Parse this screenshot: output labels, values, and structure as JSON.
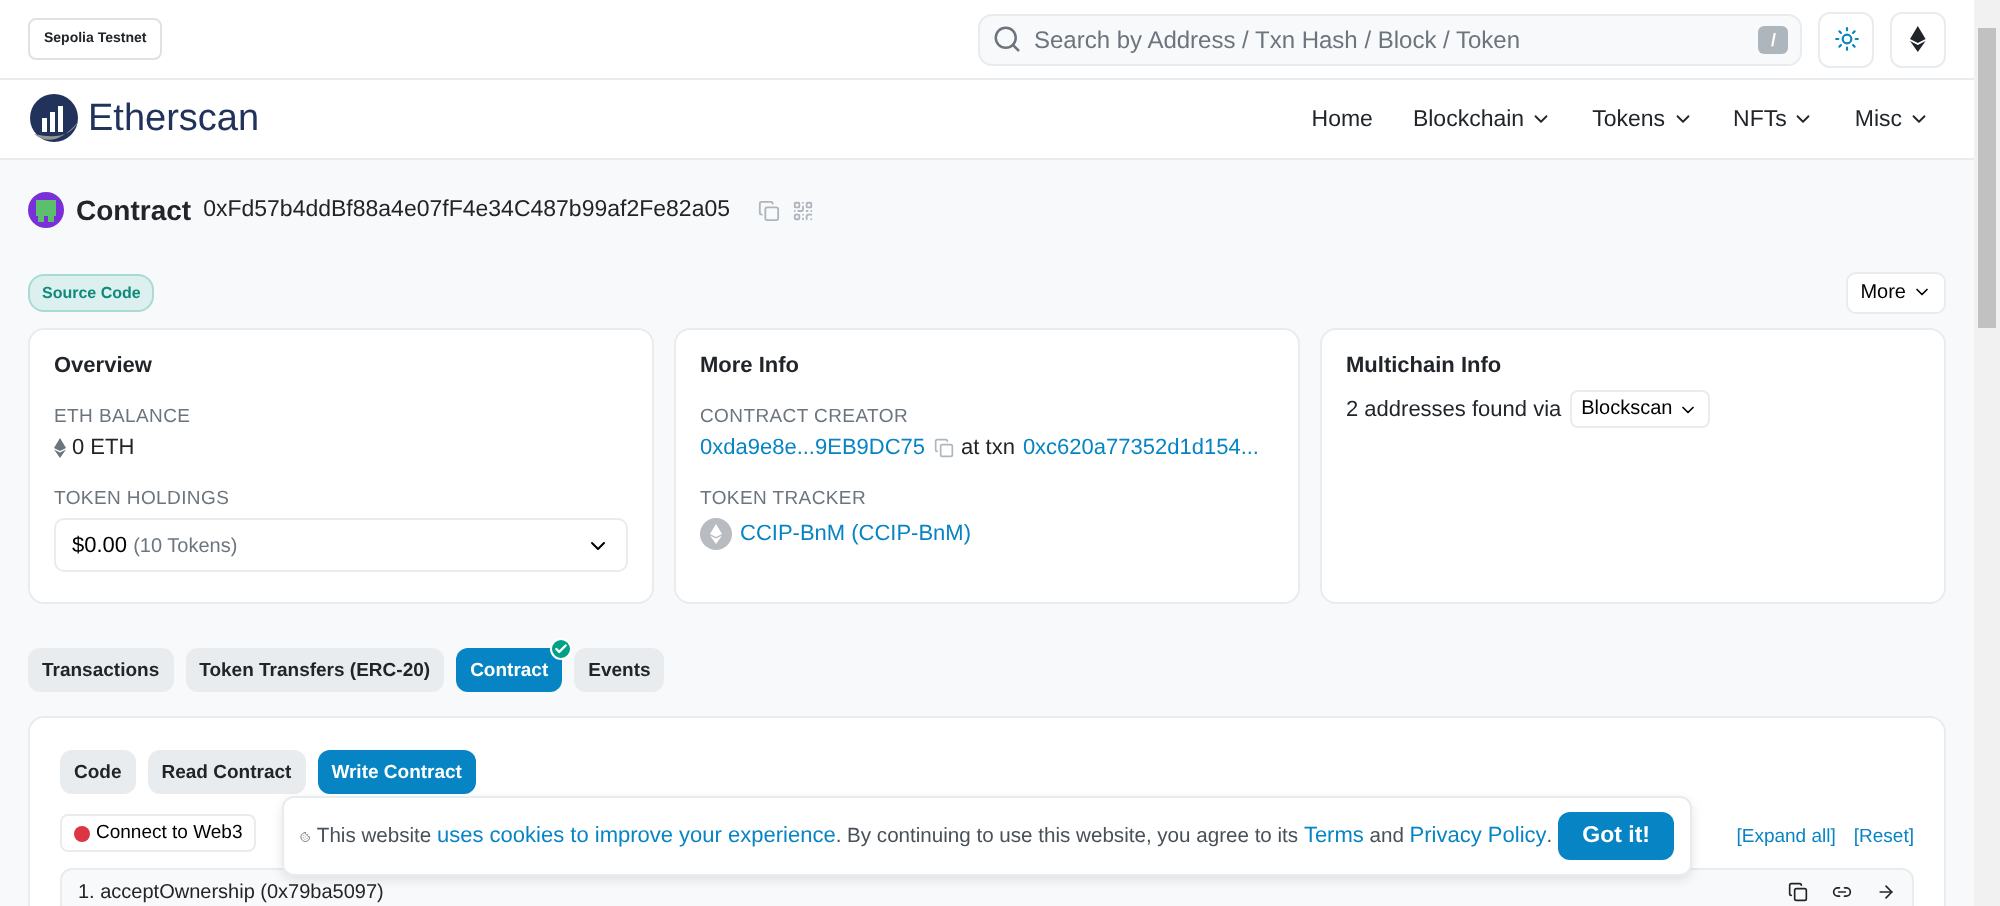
{
  "network_badge": "Sepolia Testnet",
  "search": {
    "placeholder": "Search by Address / Txn Hash / Block / Token",
    "shortcut": "/"
  },
  "brand": "Etherscan",
  "nav": [
    {
      "label": "Home",
      "dropdown": false
    },
    {
      "label": "Blockchain",
      "dropdown": true
    },
    {
      "label": "Tokens",
      "dropdown": true
    },
    {
      "label": "NFTs",
      "dropdown": true
    },
    {
      "label": "Misc",
      "dropdown": true
    }
  ],
  "page_title": {
    "label": "Contract",
    "address": "0xFd57b4ddBf88a4e07fF4e34C487b99af2Fe82a05"
  },
  "source_badge": "Source Code",
  "more_button": "More",
  "overview": {
    "title": "Overview",
    "balance_label": "ETH BALANCE",
    "balance": "0 ETH",
    "holdings_label": "TOKEN HOLDINGS",
    "holdings_value": "$0.00",
    "holdings_count": "(10 Tokens)"
  },
  "more_info": {
    "title": "More Info",
    "creator_label": "CONTRACT CREATOR",
    "creator": "0xda9e8e...9EB9DC75",
    "at_txn": "at txn",
    "txn": "0xc620a77352d1d154...",
    "tracker_label": "TOKEN TRACKER",
    "tracker": "CCIP-BnM (CCIP-BnM)"
  },
  "multichain": {
    "title": "Multichain Info",
    "text": "2 addresses found via",
    "dropdown": "Blockscan"
  },
  "tabs": [
    {
      "label": "Transactions",
      "selected": false,
      "verified": false
    },
    {
      "label": "Token Transfers (ERC-20)",
      "selected": false,
      "verified": false
    },
    {
      "label": "Contract",
      "selected": true,
      "verified": true
    },
    {
      "label": "Events",
      "selected": false,
      "verified": false
    }
  ],
  "subtabs": [
    {
      "label": "Code",
      "selected": false
    },
    {
      "label": "Read Contract",
      "selected": false
    },
    {
      "label": "Write Contract",
      "selected": true
    }
  ],
  "connect": {
    "label": "Connect to Web3",
    "connected": false
  },
  "expand_all": "[Expand all]",
  "reset": "[Reset]",
  "functions": [
    {
      "label": "1. acceptOwnership (0x79ba5097)"
    }
  ],
  "cookie_banner": {
    "segments": [
      {
        "kind": "text",
        "text": "This website "
      },
      {
        "kind": "link",
        "text": "uses cookies to improve your experience"
      },
      {
        "kind": "text",
        "text": ". By continuing to use this website, you agree to its "
      },
      {
        "kind": "link",
        "text": "Terms"
      },
      {
        "kind": "text",
        "text": " and "
      },
      {
        "kind": "link",
        "text": "Privacy Policy"
      },
      {
        "kind": "text",
        "text": "."
      }
    ],
    "button": "Got it!"
  }
}
